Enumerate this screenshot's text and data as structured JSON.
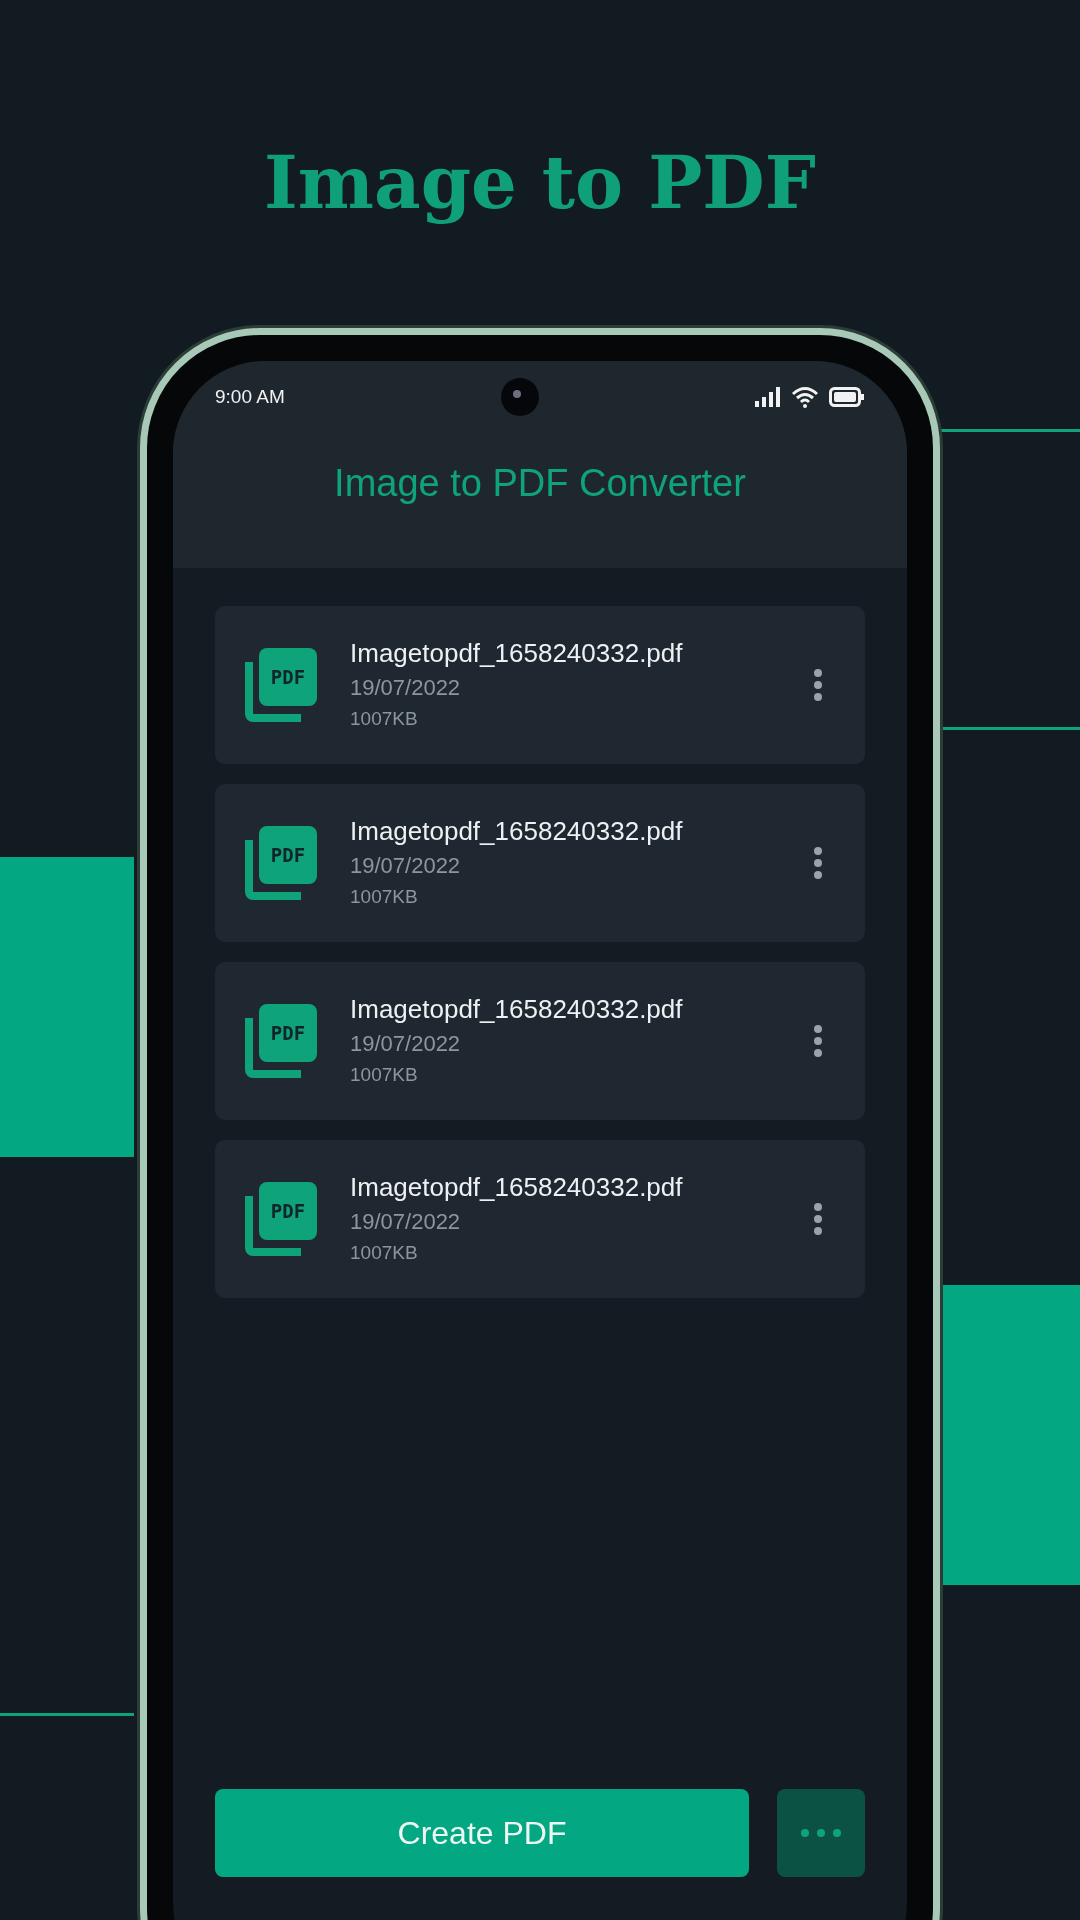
{
  "headline": "Image to PDF",
  "status_bar": {
    "time": "9:00 AM"
  },
  "app_bar": {
    "title": "Image to PDF Converter"
  },
  "files": [
    {
      "icon_label": "PDF",
      "name": "Imagetopdf_1658240332.pdf",
      "date": "19/07/2022",
      "size": "1007KB"
    },
    {
      "icon_label": "PDF",
      "name": "Imagetopdf_1658240332.pdf",
      "date": "19/07/2022",
      "size": "1007KB"
    },
    {
      "icon_label": "PDF",
      "name": "Imagetopdf_1658240332.pdf",
      "date": "19/07/2022",
      "size": "1007KB"
    },
    {
      "icon_label": "PDF",
      "name": "Imagetopdf_1658240332.pdf",
      "date": "19/07/2022",
      "size": "1007KB"
    }
  ],
  "create_button": "Create PDF"
}
